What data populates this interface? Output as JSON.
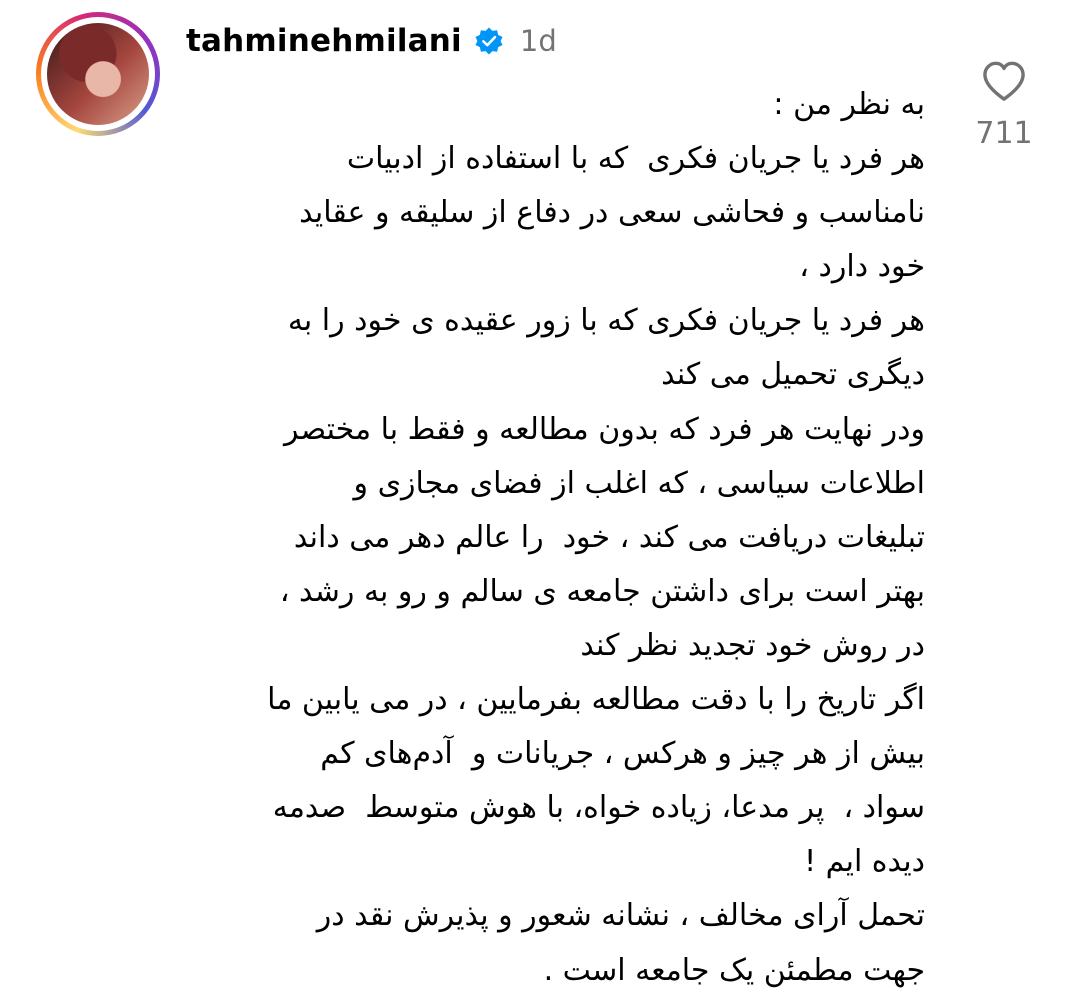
{
  "comment": {
    "username": "tahminehmilani",
    "timestamp": "1d",
    "lines": [
      "به نظر من :",
      "هر فرد یا جریان فکری  که با استفاده از ادبیات",
      "نامناسب و فحاشی سعی در دفاع از سلیقه و عقاید",
      "خود دارد ،",
      "هر فرد یا جریان فکری که با زور عقیده ی خود را به",
      "دیگری تحمیل می کند",
      "ودر نهایت هر فرد که بدون مطالعه و فقط با مختصر",
      "اطلاعات سیاسی ، که اغلب از فضای مجازی و",
      "تبلیغات دریافت می کند ، خود  را عالم دهر می داند",
      "بهتر است برای داشتن جامعه ی سالم و رو به رشد ،",
      "در روش خود تجدید نظر کند",
      "اگر تاریخ را با دقت مطالعه بفرمایین ، در می یابین ما",
      "بیش از هر چیز و هرکس ، جریانات و  آدم‌های کم",
      "سواد ،  پر مدعا، زیاده خواه، با هوش متوسط  صدمه",
      "دیده ایم !",
      "تحمل آرای مخالف ، نشانه شعور و پذیرش نقد در",
      "جهت مطمئن یک جامعه است ."
    ],
    "like_count": "711"
  },
  "icons": {
    "verified": "verified-badge-icon",
    "like": "heart-outline-icon"
  },
  "colors": {
    "verified_blue": "#0095f6",
    "muted_text": "#737373"
  }
}
